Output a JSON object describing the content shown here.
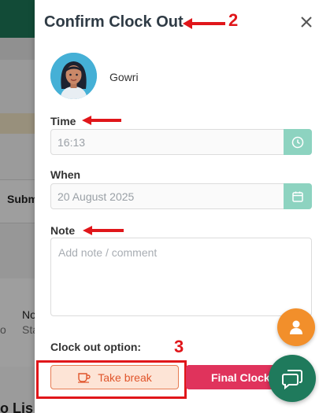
{
  "background": {
    "submit_fragment": "Subm",
    "no_fragment": "No",
    "sta_fragment": "Sta",
    "o_fragment": "o",
    "list_fragment": "o Lis"
  },
  "dialog": {
    "title": "Confirm Clock Out",
    "user": {
      "name": "Gowri"
    },
    "time": {
      "label": "Time",
      "value": "16:13"
    },
    "when": {
      "label": "When",
      "value": "20 August 2025"
    },
    "note": {
      "label": "Note",
      "placeholder": "Add note / comment"
    },
    "clock_out_option_label": "Clock out option:",
    "take_break_label": "Take break",
    "final_clock_label": "Final Clock"
  },
  "annotations": {
    "title_marker": "2",
    "button_marker": "3"
  },
  "colors": {
    "accent_green": "#1e7a5a",
    "field_button": "#8dd3c0",
    "take_break_fill": "#fde4d6",
    "take_break_text": "#e0552b",
    "final_clock_fill": "#e0335c",
    "fab_orange": "#f28f2b",
    "annotation_red": "#e0161a"
  },
  "icons": [
    "close-icon",
    "clock-icon",
    "calendar-icon",
    "coffee-cup-icon",
    "user-icon",
    "chat-icon",
    "arrow-icon"
  ]
}
